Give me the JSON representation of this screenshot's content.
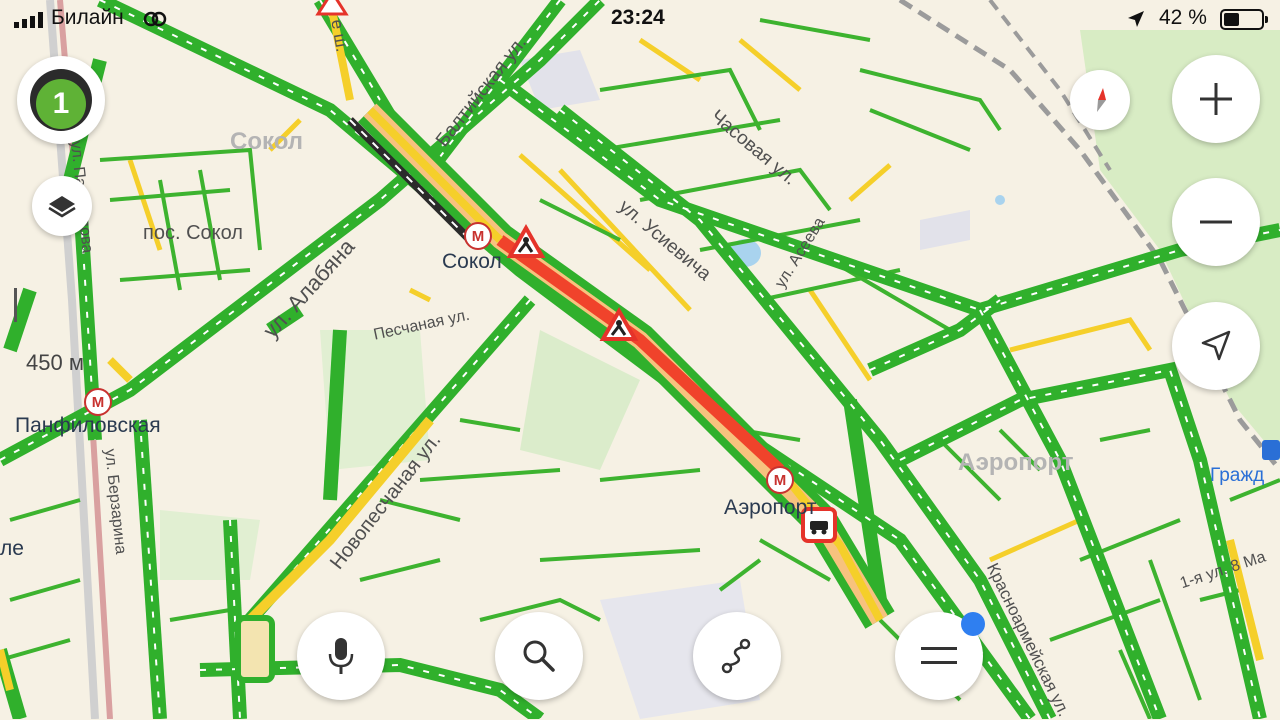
{
  "status_bar": {
    "carrier": "Билайн",
    "time": "23:24",
    "battery_percent": "42 %",
    "battery_level": 0.42
  },
  "traffic": {
    "level": "1",
    "level_color": "#5fb236",
    "free_color": "#30b02c",
    "slow_color": "#f5cf2a",
    "jam_color": "#f0432b"
  },
  "scale": {
    "label": "450 м"
  },
  "labels": {
    "sokol_district": "Сокол",
    "pos_sokol": "пос. Сокол",
    "alabyana": "ул. Алабяна",
    "baltiyskaya": "Балтийская ул.",
    "peschanaya": "Песчаная ул.",
    "novopeschanaya": "Новопесчаная ул.",
    "usievicha": "ул. Усиевича",
    "chasovaya": "Часовая ул.",
    "aseeva": "ул. Асеева",
    "aeroport_district": "Аэропорт",
    "krasnoarmeyskaya": "Красноармейская ул.",
    "first_8_marta": "1-я ул. 8 Ма",
    "berzarina": "ул. Берзарина",
    "panfilova": "ул. Панфилова",
    "shosse_partial": "е ш.",
    "left_partial": "ле",
    "right_partial": "Гражд"
  },
  "metro_stations": {
    "sokol": "Сокол",
    "panfilovskaya": "Панфиловская",
    "aeroport": "Аэропорт",
    "symbol": "М"
  },
  "icons": {
    "layers": "layers-icon",
    "compass": "compass-icon",
    "zoom_in": "plus-icon",
    "zoom_out": "minus-icon",
    "locate": "location-arrow-icon",
    "voice": "microphone-icon",
    "search": "search-icon",
    "route": "route-icon",
    "menu": "menu-icon",
    "roadworks": "roadworks-icon",
    "accident": "accident-icon"
  }
}
